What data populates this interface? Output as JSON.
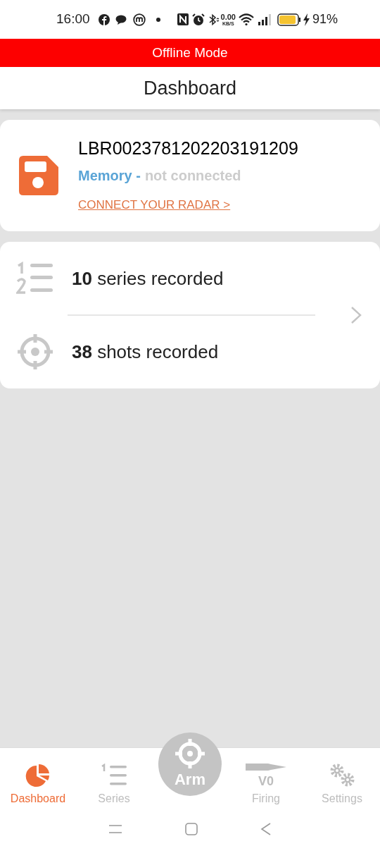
{
  "status_bar": {
    "time": "16:00",
    "speed": "0.00",
    "speed_unit": "KB/S",
    "battery": "91%"
  },
  "banner": {
    "text": "Offline Mode"
  },
  "header": {
    "title": "Dashboard"
  },
  "device": {
    "id": "LBR0023781202203191209",
    "source": "Memory -",
    "status": "not connected",
    "link": "CONNECT YOUR RADAR >"
  },
  "stats": [
    {
      "kind": "series",
      "text": "**10** series recorded"
    },
    {
      "kind": "shots",
      "text": "**38** shots recorded"
    }
  ],
  "nav": [
    {
      "kind": "dashboard",
      "label": "Dashboard",
      "selected": true
    },
    {
      "kind": "series",
      "label": "Series",
      "selected": false
    },
    {
      "kind": "arm",
      "label": "Arm",
      "selected": false
    },
    {
      "kind": "firing",
      "label": "Firing",
      "badge": "V0",
      "selected": false
    },
    {
      "kind": "settings",
      "label": "Settings",
      "selected": false
    }
  ]
}
